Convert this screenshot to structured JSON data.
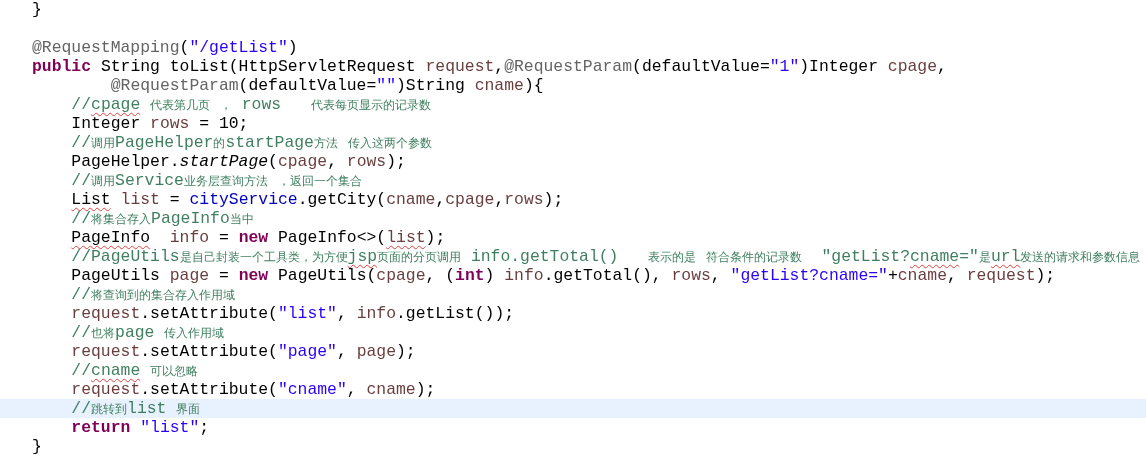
{
  "editor": {
    "lines": [
      {
        "highlighted": false,
        "tokens": [
          {
            "text": "}",
            "kind": "plain"
          }
        ]
      },
      {
        "highlighted": false
      },
      {
        "highlighted": false,
        "tokens": [
          {
            "text": "@RequestMapping",
            "kind": "annotation"
          },
          {
            "text": "(",
            "kind": "plain"
          },
          {
            "text": "\"/getList\"",
            "kind": "string"
          },
          {
            "text": ")",
            "kind": "plain"
          }
        ]
      },
      {
        "highlighted": false,
        "tokens": [
          {
            "text": "public",
            "kind": "keyword"
          },
          {
            "text": " String toList(HttpServletRequest ",
            "kind": "plain"
          },
          {
            "text": "request",
            "kind": "local"
          },
          {
            "text": ",",
            "kind": "plain"
          },
          {
            "text": "@RequestParam",
            "kind": "annotation"
          },
          {
            "text": "(defaultValue=",
            "kind": "plain"
          },
          {
            "text": "\"1\"",
            "kind": "string"
          },
          {
            "text": ")Integer ",
            "kind": "plain"
          },
          {
            "text": "cpage",
            "kind": "local"
          },
          {
            "text": ",",
            "kind": "plain"
          }
        ]
      },
      {
        "highlighted": false,
        "tokens": [
          {
            "text": "        @RequestParam",
            "kind": "annotation"
          },
          {
            "text": "(defaultValue=",
            "kind": "plain"
          },
          {
            "text": "\"\"",
            "kind": "string"
          },
          {
            "text": ")String ",
            "kind": "plain"
          },
          {
            "text": "cname",
            "kind": "local"
          },
          {
            "text": "){",
            "kind": "plain"
          }
        ]
      },
      {
        "highlighted": false,
        "tokens": [
          {
            "text": "    //",
            "kind": "comment"
          },
          {
            "text": "cpage",
            "kind": "comment",
            "sq": true
          },
          {
            "text": " 代表第几页 ， rows   代表每页显示的记录数",
            "kind": "comment"
          }
        ]
      },
      {
        "highlighted": false,
        "tokens": [
          {
            "text": "    Integer ",
            "kind": "plain"
          },
          {
            "text": "rows",
            "kind": "local"
          },
          {
            "text": " = 10;",
            "kind": "plain"
          }
        ]
      },
      {
        "highlighted": false,
        "tokens": [
          {
            "text": "    //调用PageHelper的startPage方法 传入这两个参数",
            "kind": "comment"
          }
        ]
      },
      {
        "highlighted": false,
        "tokens": [
          {
            "text": "    PageHelper.",
            "kind": "plain"
          },
          {
            "text": "startPage",
            "kind": "static"
          },
          {
            "text": "(",
            "kind": "plain"
          },
          {
            "text": "cpage",
            "kind": "local"
          },
          {
            "text": ", ",
            "kind": "plain"
          },
          {
            "text": "rows",
            "kind": "local"
          },
          {
            "text": ");",
            "kind": "plain"
          }
        ]
      },
      {
        "highlighted": false,
        "tokens": [
          {
            "text": "    //调用Service业务层查询方法 ，返回一个集合",
            "kind": "comment"
          }
        ]
      },
      {
        "highlighted": false,
        "tokens": [
          {
            "text": "    List",
            "kind": "plain",
            "sq": true
          },
          {
            "text": " list",
            "kind": "local"
          },
          {
            "text": " = ",
            "kind": "plain"
          },
          {
            "text": "cityService",
            "kind": "field"
          },
          {
            "text": ".getCity(",
            "kind": "plain"
          },
          {
            "text": "cname",
            "kind": "local"
          },
          {
            "text": ",",
            "kind": "plain"
          },
          {
            "text": "cpage",
            "kind": "local"
          },
          {
            "text": ",",
            "kind": "plain"
          },
          {
            "text": "rows",
            "kind": "local"
          },
          {
            "text": ");",
            "kind": "plain"
          }
        ]
      },
      {
        "highlighted": false,
        "tokens": [
          {
            "text": "    //将集合存入PageInfo当中",
            "kind": "comment"
          }
        ]
      },
      {
        "highlighted": false,
        "tokens": [
          {
            "text": "    PageInfo",
            "kind": "plain",
            "sq": true
          },
          {
            "text": "  info",
            "kind": "local"
          },
          {
            "text": " = ",
            "kind": "plain"
          },
          {
            "text": "new",
            "kind": "keyword"
          },
          {
            "text": " PageInfo<>(",
            "kind": "plain"
          },
          {
            "text": "list",
            "kind": "local",
            "sq": true
          },
          {
            "text": ");",
            "kind": "plain"
          }
        ]
      },
      {
        "highlighted": false,
        "tokens": [
          {
            "text": "    //PageUtils是自己封装一个工具类，为方便",
            "kind": "comment"
          },
          {
            "text": "jsp",
            "kind": "comment",
            "sq": true
          },
          {
            "text": "页面的分页调用 info.getTotal()   表示的是 符合条件的记录数  \"getList?",
            "kind": "comment"
          },
          {
            "text": "cname",
            "kind": "comment",
            "sq": true
          },
          {
            "text": "=\"是",
            "kind": "comment"
          },
          {
            "text": "url",
            "kind": "comment",
            "sq": true
          },
          {
            "text": "发送的请求和参数信息",
            "kind": "comment"
          }
        ]
      },
      {
        "highlighted": false,
        "tokens": [
          {
            "text": "    PageUtils ",
            "kind": "plain"
          },
          {
            "text": "page",
            "kind": "local"
          },
          {
            "text": " = ",
            "kind": "plain"
          },
          {
            "text": "new",
            "kind": "keyword"
          },
          {
            "text": " PageUtils(",
            "kind": "plain"
          },
          {
            "text": "cpage",
            "kind": "local"
          },
          {
            "text": ", (",
            "kind": "plain"
          },
          {
            "text": "int",
            "kind": "keyword"
          },
          {
            "text": ") ",
            "kind": "plain"
          },
          {
            "text": "info",
            "kind": "local"
          },
          {
            "text": ".getTotal(), ",
            "kind": "plain"
          },
          {
            "text": "rows",
            "kind": "local"
          },
          {
            "text": ", ",
            "kind": "plain"
          },
          {
            "text": "\"getList?cname=\"",
            "kind": "string"
          },
          {
            "text": "+",
            "kind": "plain"
          },
          {
            "text": "cname",
            "kind": "local"
          },
          {
            "text": ", ",
            "kind": "plain"
          },
          {
            "text": "request",
            "kind": "local"
          },
          {
            "text": ");",
            "kind": "plain"
          }
        ]
      },
      {
        "highlighted": false,
        "tokens": [
          {
            "text": "    //将查询到的集合存入作用域",
            "kind": "comment"
          }
        ]
      },
      {
        "highlighted": false,
        "tokens": [
          {
            "text": "    request",
            "kind": "local"
          },
          {
            "text": ".setAttribute(",
            "kind": "plain"
          },
          {
            "text": "\"list\"",
            "kind": "string"
          },
          {
            "text": ", ",
            "kind": "plain"
          },
          {
            "text": "info",
            "kind": "local"
          },
          {
            "text": ".getList());",
            "kind": "plain"
          }
        ]
      },
      {
        "highlighted": false,
        "tokens": [
          {
            "text": "    //也将page 传入作用域",
            "kind": "comment"
          }
        ]
      },
      {
        "highlighted": false,
        "tokens": [
          {
            "text": "    request",
            "kind": "local"
          },
          {
            "text": ".setAttribute(",
            "kind": "plain"
          },
          {
            "text": "\"page\"",
            "kind": "string"
          },
          {
            "text": ", ",
            "kind": "plain"
          },
          {
            "text": "page",
            "kind": "local"
          },
          {
            "text": ");",
            "kind": "plain"
          }
        ]
      },
      {
        "highlighted": false,
        "tokens": [
          {
            "text": "    //",
            "kind": "comment"
          },
          {
            "text": "cname",
            "kind": "comment",
            "sq": true
          },
          {
            "text": " 可以忽略",
            "kind": "comment"
          }
        ]
      },
      {
        "highlighted": false,
        "tokens": [
          {
            "text": "    request",
            "kind": "local"
          },
          {
            "text": ".setAttribute(",
            "kind": "plain"
          },
          {
            "text": "\"cname\"",
            "kind": "string"
          },
          {
            "text": ", ",
            "kind": "plain"
          },
          {
            "text": "cname",
            "kind": "local"
          },
          {
            "text": ");",
            "kind": "plain"
          }
        ]
      },
      {
        "highlighted": true,
        "tokens": [
          {
            "text": "    //跳转到list 界面",
            "kind": "comment"
          }
        ]
      },
      {
        "highlighted": false,
        "tokens": [
          {
            "text": "    return",
            "kind": "keyword"
          },
          {
            "text": " \"list\"",
            "kind": "string"
          },
          {
            "text": ";",
            "kind": "plain"
          }
        ]
      },
      {
        "highlighted": false,
        "tokens": [
          {
            "text": "}",
            "kind": "plain"
          }
        ]
      }
    ]
  }
}
